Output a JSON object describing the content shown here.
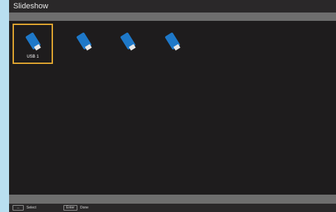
{
  "window": {
    "title": "Slideshow"
  },
  "devices": [
    {
      "label": "USB 1",
      "icon": "usb-drive-icon",
      "selected": true
    },
    {
      "label": "",
      "icon": "usb-drive-icon",
      "selected": false
    },
    {
      "label": "",
      "icon": "usb-drive-icon",
      "selected": false
    },
    {
      "label": "",
      "icon": "usb-drive-icon",
      "selected": false
    }
  ],
  "footer": {
    "select_key": "↔",
    "select_label": "Select",
    "done_key": "Enter",
    "done_label": "Done"
  },
  "colors": {
    "background": "#1e1c1d",
    "frame": "#b9dff0",
    "selection": "#e1a630",
    "usb": "#1e78c8"
  }
}
